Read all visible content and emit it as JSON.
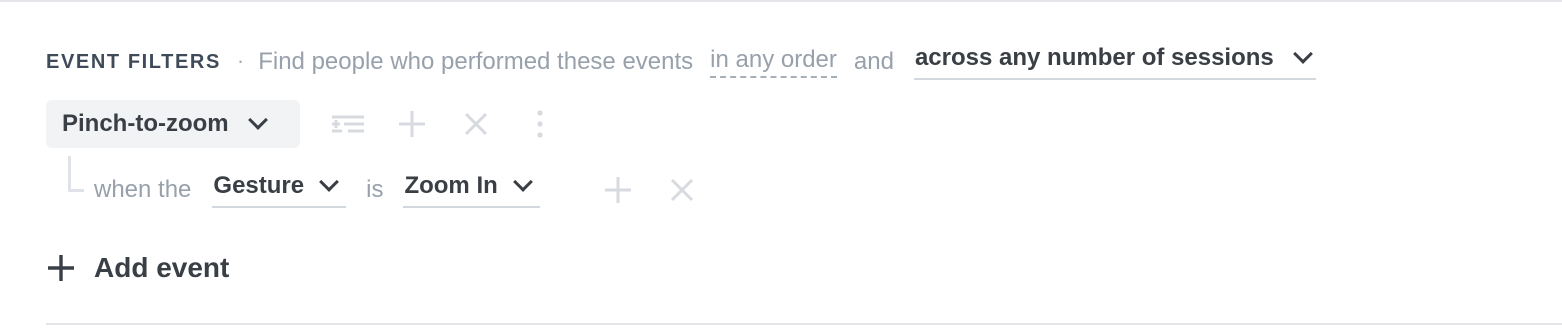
{
  "filters": {
    "title": "EVENT FILTERS",
    "separator": "·",
    "description": "Find people who performed these events",
    "order_option": "in any order",
    "conjunction": "and",
    "session_option": "across any number of sessions"
  },
  "event": {
    "name": "Pinch-to-zoom",
    "actions": [
      "filter-icon",
      "add-icon",
      "remove-icon",
      "more-icon"
    ]
  },
  "condition": {
    "prefix": "when the",
    "property": "Gesture",
    "operator": "is",
    "value": "Zoom In"
  },
  "add_event": {
    "label": "Add event"
  },
  "colors": {
    "text_dark": "#3a3f45",
    "text_muted": "#98a1ab",
    "icon_muted": "#d7dbe0",
    "pill_bg": "#f2f3f5",
    "divider": "#e3e5e8"
  }
}
